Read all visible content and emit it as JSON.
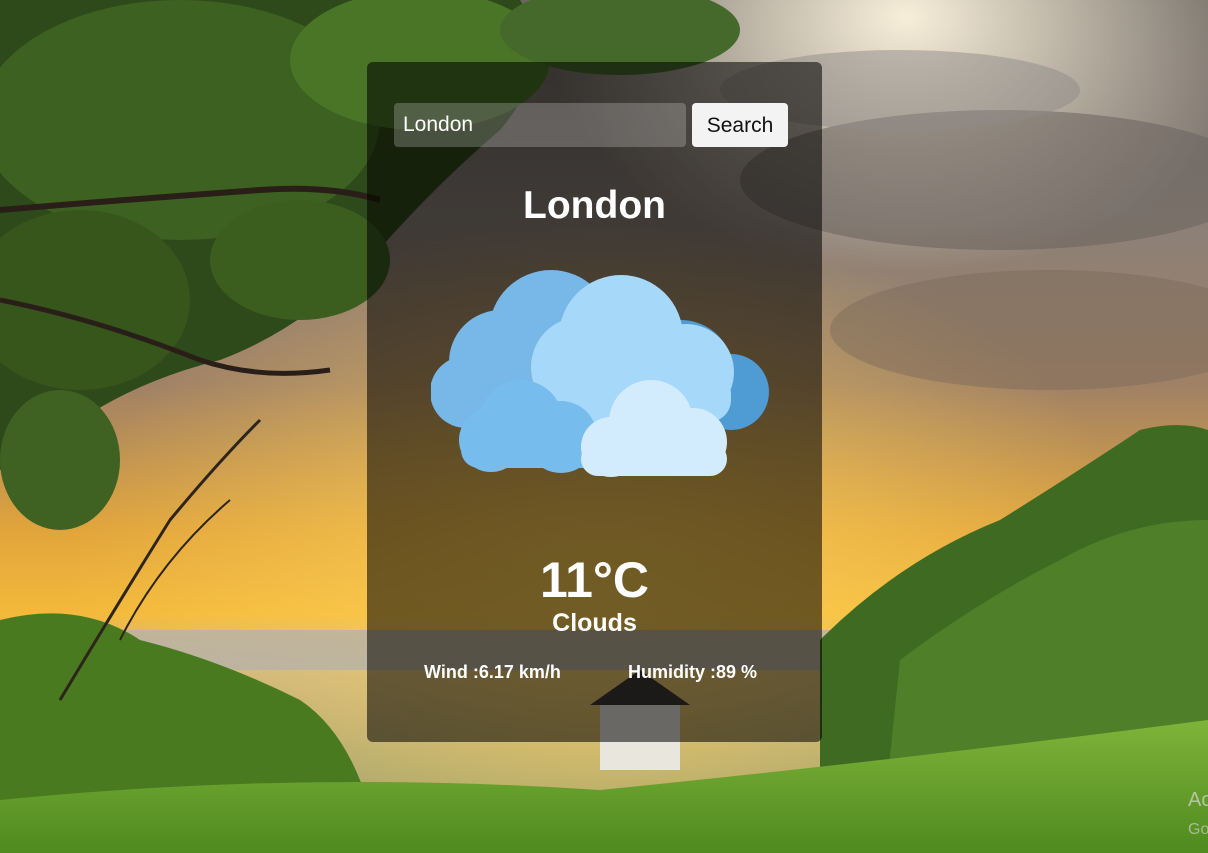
{
  "search": {
    "value": "London",
    "button_label": "Search"
  },
  "weather": {
    "city": "London",
    "icon": "clouds-icon",
    "temperature": "11°C",
    "condition": "Clouds",
    "wind_label": "Wind :",
    "wind_value": "6.17 km/h",
    "humidity_label": "Humidity :",
    "humidity_value": "89 %"
  },
  "colors": {
    "card_overlay": "#000000",
    "text": "#ffffff",
    "button_bg": "#f3f3f3",
    "cloud_dark": "#5aa6dc",
    "cloud_mid": "#8fcaf2",
    "cloud_light": "#d3ecfd"
  }
}
